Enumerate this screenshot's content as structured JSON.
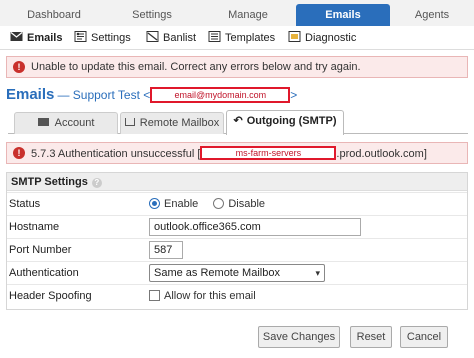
{
  "topnav": {
    "tabs": [
      "Dashboard",
      "Settings",
      "Manage",
      "Emails",
      "Agents"
    ],
    "active": "Emails"
  },
  "subnav": {
    "items": [
      {
        "label": "Emails",
        "icon": "envelope-icon"
      },
      {
        "label": "Settings",
        "icon": "settings-icon"
      },
      {
        "label": "Banlist",
        "icon": "banlist-icon"
      },
      {
        "label": "Templates",
        "icon": "templates-icon"
      },
      {
        "label": "Diagnostic",
        "icon": "diagnostic-icon"
      }
    ]
  },
  "error_banner": {
    "icon": "!",
    "text": "Unable to update this email. Correct any errors below and try again."
  },
  "header": {
    "title": "Emails",
    "subtitle_prefix": "— Support Test <",
    "email_redacted": "email@mydomain.com",
    "subtitle_suffix": ">"
  },
  "inner_tabs": [
    {
      "label": "Account",
      "icon": "envelope-icon"
    },
    {
      "label": "Remote Mailbox",
      "icon": "inbox-icon"
    },
    {
      "label": "Outgoing (SMTP)",
      "icon": "reply-icon",
      "active": true
    }
  ],
  "smtp_error": {
    "icon": "!",
    "prefix": "5.7.3 Authentication unsuccessful [",
    "redacted": "ms-farm-servers",
    "suffix": ".prod.outlook.com]"
  },
  "panel": {
    "title": "SMTP Settings",
    "help_icon": "?",
    "rows": {
      "status": {
        "label": "Status",
        "enable": "Enable",
        "disable": "Disable",
        "selected": "Enable"
      },
      "hostname": {
        "label": "Hostname",
        "value": "outlook.office365.com"
      },
      "port": {
        "label": "Port Number",
        "value": "587"
      },
      "auth": {
        "label": "Authentication",
        "value": "Same as Remote Mailbox"
      },
      "spoof": {
        "label": "Header Spoofing",
        "checkbox_label": "Allow for this email",
        "checked": false
      }
    }
  },
  "buttons": {
    "save": "Save Changes",
    "reset": "Reset",
    "cancel": "Cancel"
  },
  "colors": {
    "accent": "#2a6ebb",
    "error_bg": "#fbeaea",
    "redaction": "#e0182b"
  }
}
